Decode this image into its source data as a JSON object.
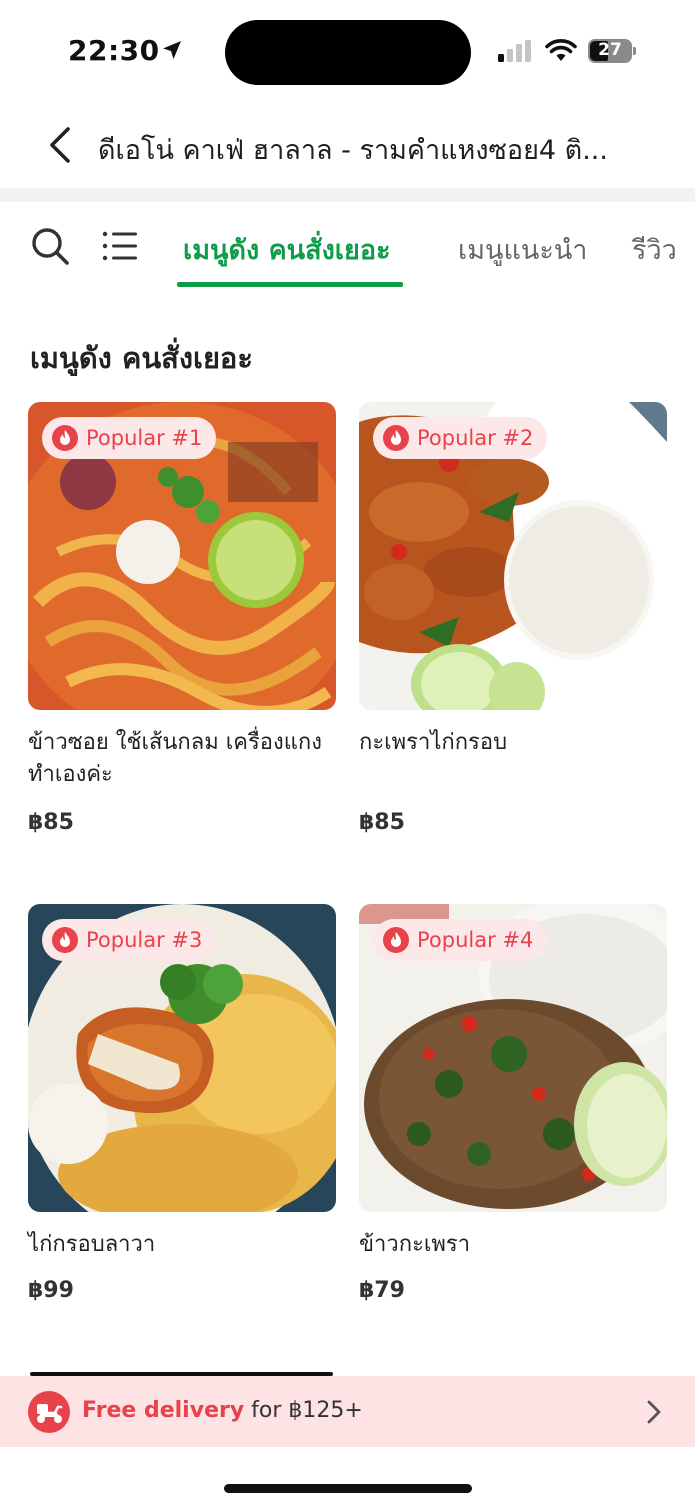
{
  "status_bar": {
    "time": "22:30",
    "battery": "27"
  },
  "header": {
    "title": "ดีเอโน่ คาเฟ่ ฮาลาล - รามคำแหงซอย4 ติ..."
  },
  "tabs": [
    {
      "label": "เมนูดัง คนสั่งเยอะ",
      "active": true
    },
    {
      "label": "เมนูแนะนำ",
      "active": false
    },
    {
      "label": "รีวิว",
      "active": false
    }
  ],
  "section": {
    "title": "เมนูดัง คนสั่งเยอะ"
  },
  "items": [
    {
      "badge": "Popular #1",
      "name": "ข้าวซอย ใช้เส้นกลม เครื่องแกงทำเองค่ะ",
      "price": "฿85"
    },
    {
      "badge": "Popular #2",
      "name": "กะเพราไก่กรอบ",
      "price": "฿85"
    },
    {
      "badge": "Popular #3",
      "name": "ไก่กรอบลาวา",
      "price": "฿99"
    },
    {
      "badge": "Popular #4",
      "name": "ข้าวกะเพรา",
      "price": "฿79"
    }
  ],
  "promo": {
    "highlight": "Free delivery",
    "rest": " for ฿125+"
  },
  "colors": {
    "accent_green": "#0d9d48",
    "badge_red": "#e8424b",
    "promo_bg": "#fde3e4"
  },
  "icons": [
    "location-arrow-icon",
    "cellular-signal-icon",
    "wifi-icon",
    "battery-icon",
    "back-chevron-icon",
    "search-icon",
    "list-icon",
    "flame-icon",
    "delivery-scooter-icon",
    "chevron-right-icon"
  ]
}
